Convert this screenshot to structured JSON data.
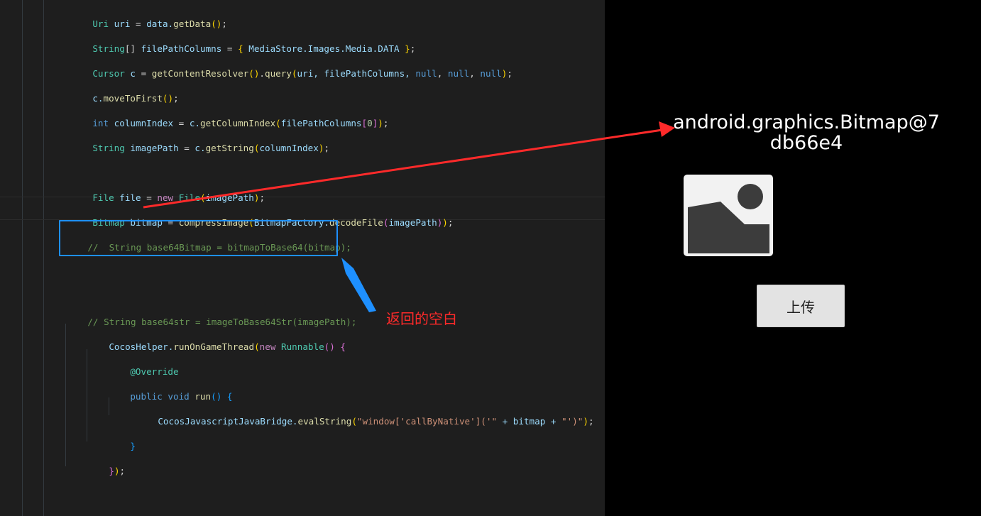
{
  "editor": {
    "lines": {
      "l1": {
        "a": "Uri",
        "b": " uri ",
        "c": "=",
        "d": " data.",
        "e": "getData",
        "f": "()",
        "g": ";"
      },
      "l2": {
        "a": "String",
        "b": "[]",
        "c": " filePathColumns ",
        "d": "=",
        "e": " {",
        "f": " MediaStore.Images.Media.DATA ",
        "g": "}",
        "h": ";"
      },
      "l3": {
        "a": "Cursor",
        "b": " c ",
        "c": "=",
        "d": " getContentResolver",
        "e": "()",
        "f": ".",
        "g": "query",
        "h": "(",
        "i": "uri, filePathColumns, ",
        "j": "null",
        "k": ", ",
        "l": "null",
        "m": ", ",
        "n": "null",
        "o": ")",
        "p": ";"
      },
      "l4": {
        "a": "c.",
        "b": "moveToFirst",
        "c": "()",
        "d": ";"
      },
      "l5": {
        "a": "int",
        "b": " columnIndex ",
        "c": "=",
        "d": " c.",
        "e": "getColumnIndex",
        "f": "(",
        "g": "filePathColumns",
        "h": "[",
        "i": "0",
        "j": "]",
        "k": ")",
        "l": ";"
      },
      "l6": {
        "a": "String",
        "b": " imagePath ",
        "c": "=",
        "d": " c.",
        "e": "getString",
        "f": "(",
        "g": "columnIndex",
        "h": ")",
        "i": ";"
      },
      "l7": {
        "a": "File",
        "b": " file ",
        "c": "=",
        "d": " new",
        "e": " File",
        "f": "(",
        "g": "imagePath",
        "h": ")",
        "i": ";"
      },
      "l8": {
        "a": "Bitmap",
        "b": " bitmap ",
        "c": "=",
        "d": " compressImage",
        "e": "(",
        "f": "BitmapFactory.",
        "g": "decodeFile",
        "h": "(",
        "i": "imagePath",
        "j": ")",
        "k": ")",
        "l": ";"
      },
      "l9": {
        "a": "//  String base64Bitmap = bitmapToBase64(bitmap);"
      },
      "l10": {
        "a": "// String base64str = imageToBase64Str(imagePath);"
      },
      "l11": {
        "a": "CocosHelper.",
        "b": "runOnGameThread",
        "c": "(",
        "d": "new",
        "e": " Runnable",
        "f": "()",
        "g": " {"
      },
      "l12": {
        "a": "@Override"
      },
      "l13": {
        "a": "public",
        "b": " void",
        "c": " run",
        "d": "()",
        "e": " {"
      },
      "l14": {
        "a": "CocosJavascriptJavaBridge.",
        "b": "evalString",
        "c": "(",
        "d": "\"window['callByNative']('\"",
        "e": " + bitmap + ",
        "f": "\"')\"",
        "g": ")",
        "h": ";"
      },
      "l15": {
        "a": "}"
      },
      "l16": {
        "a": "}",
        "b": ")",
        "c": ";"
      }
    }
  },
  "annotation": {
    "label": "返回的空白",
    "arrow_color": "#ff2a2a",
    "box_color": "#1e90ff"
  },
  "device": {
    "bitmap_text": "android.graphics.Bitmap@7db66e4",
    "image_icon": "image-placeholder-icon",
    "upload_label": "上传"
  }
}
